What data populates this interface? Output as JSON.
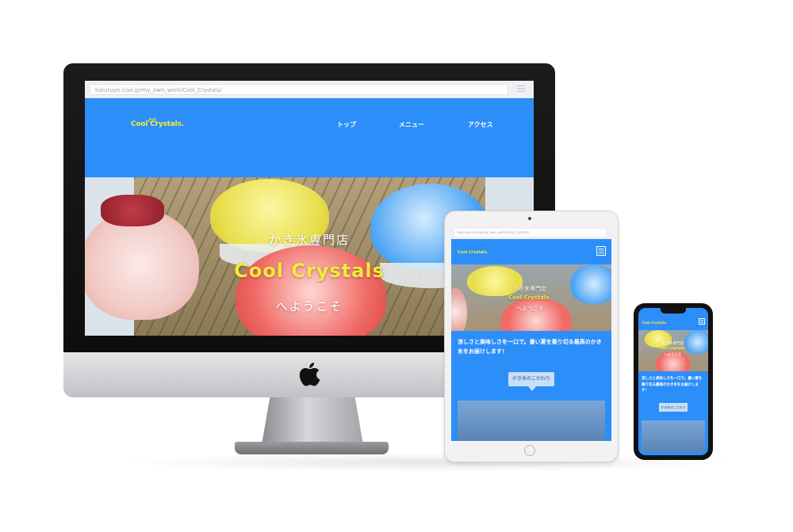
{
  "desktop": {
    "address_bar": {
      "url": "tukuruyo.ciao.jp/my_own_work/Cool_Crystals/"
    },
    "site": {
      "logo": "Cool Crystals.",
      "nav": [
        "トップ",
        "メニュー",
        "アクセス"
      ],
      "hero": {
        "subtitle": "かき氷専門店",
        "title": "Cool Crystals",
        "welcome": "へようこそ"
      }
    }
  },
  "tablet": {
    "address_bar": {
      "url": "tukuruyo.ciao.jp/my_own_work/Cool_Crystals/"
    },
    "logo": "Cool Crystals.",
    "hero": {
      "subtitle": "かき氷専門店",
      "title": "Cool Crystals",
      "welcome": "へようこそ"
    },
    "intro_text": "涼しさと美味しさを一口で。暑い夏を乗り切る最高のかき氷をお届けします！",
    "callout": "かき氷のこだわり"
  },
  "phone": {
    "logo": "Cool Crystals.",
    "hero": {
      "subtitle": "かき氷専門店",
      "title": "Cool Crystals",
      "welcome": "へようこそ"
    },
    "intro_text": "涼しさと美味しさを一口で。暑い夏を乗り切る最高のかき氷をお届けします！",
    "callout": "かき氷のこだわり"
  },
  "colors": {
    "brand_blue": "#2c8ef8",
    "logo_yellow": "#f4ea3a",
    "callout_bg": "#c8dffa"
  },
  "icons": [
    "apple-logo-icon",
    "hamburger-menu-icon",
    "crown-icon"
  ]
}
